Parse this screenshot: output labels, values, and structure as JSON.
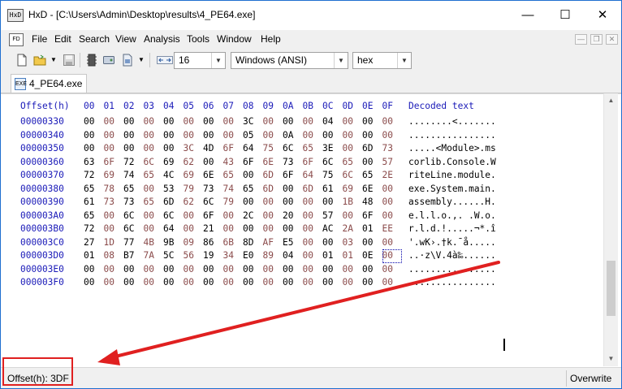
{
  "window": {
    "title": "HxD - [C:\\Users\\Admin\\Desktop\\results\\4_PE64.exe]",
    "app_icon_text": "HxD",
    "minimize": "—",
    "maximize": "☐",
    "close": "✕"
  },
  "menu": {
    "doc_icon_text": "FD",
    "items": [
      "File",
      "Edit",
      "Search",
      "View",
      "Analysis",
      "Tools",
      "Window",
      "Help"
    ],
    "mdi_buttons": [
      "—",
      "❐",
      "✕"
    ]
  },
  "toolbar": {
    "icons": [
      "new-icon",
      "open-icon",
      "save-icon",
      "ram-icon",
      "disk-icon",
      "file-icon",
      "bytes-per-row-icon"
    ],
    "bytes_per_row": "16",
    "charset": "Windows (ANSI)",
    "offset_base": "hex"
  },
  "tab": {
    "icon_text": "EXE",
    "label": "4_PE64.exe"
  },
  "hex_view": {
    "offset_header": "Offset(h)",
    "column_headers": [
      "00",
      "01",
      "02",
      "03",
      "04",
      "05",
      "06",
      "07",
      "08",
      "09",
      "0A",
      "0B",
      "0C",
      "0D",
      "0E",
      "0F"
    ],
    "decoded_header": "Decoded text",
    "rows": [
      {
        "offset": "00000330",
        "bytes": [
          "00",
          "00",
          "00",
          "00",
          "00",
          "00",
          "00",
          "00",
          "3C",
          "00",
          "00",
          "00",
          "04",
          "00",
          "00",
          "00"
        ],
        "text": "........<......."
      },
      {
        "offset": "00000340",
        "bytes": [
          "00",
          "00",
          "00",
          "00",
          "00",
          "00",
          "00",
          "00",
          "05",
          "00",
          "0A",
          "00",
          "00",
          "00",
          "00",
          "00"
        ],
        "text": "................"
      },
      {
        "offset": "00000350",
        "bytes": [
          "00",
          "00",
          "00",
          "00",
          "00",
          "3C",
          "4D",
          "6F",
          "64",
          "75",
          "6C",
          "65",
          "3E",
          "00",
          "6D",
          "73"
        ],
        "text": ".....<Module>.ms"
      },
      {
        "offset": "00000360",
        "bytes": [
          "63",
          "6F",
          "72",
          "6C",
          "69",
          "62",
          "00",
          "43",
          "6F",
          "6E",
          "73",
          "6F",
          "6C",
          "65",
          "00",
          "57"
        ],
        "text": "corlib.Console.W"
      },
      {
        "offset": "00000370",
        "bytes": [
          "72",
          "69",
          "74",
          "65",
          "4C",
          "69",
          "6E",
          "65",
          "00",
          "6D",
          "6F",
          "64",
          "75",
          "6C",
          "65",
          "2E"
        ],
        "text": "riteLine.module."
      },
      {
        "offset": "00000380",
        "bytes": [
          "65",
          "78",
          "65",
          "00",
          "53",
          "79",
          "73",
          "74",
          "65",
          "6D",
          "00",
          "6D",
          "61",
          "69",
          "6E",
          "00"
        ],
        "text": "exe.System.main."
      },
      {
        "offset": "00000390",
        "bytes": [
          "61",
          "73",
          "73",
          "65",
          "6D",
          "62",
          "6C",
          "79",
          "00",
          "00",
          "00",
          "00",
          "00",
          "1B",
          "48",
          "00"
        ],
        "text": "assembly......H."
      },
      {
        "offset": "000003A0",
        "bytes": [
          "65",
          "00",
          "6C",
          "00",
          "6C",
          "00",
          "6F",
          "00",
          "2C",
          "00",
          "20",
          "00",
          "57",
          "00",
          "6F",
          "00"
        ],
        "text": "e.l.l.o.,. .W.o."
      },
      {
        "offset": "000003B0",
        "bytes": [
          "72",
          "00",
          "6C",
          "00",
          "64",
          "00",
          "21",
          "00",
          "00",
          "00",
          "00",
          "00",
          "AC",
          "2A",
          "01",
          "EE"
        ],
        "text": "r.l.d.!.....¬*.î"
      },
      {
        "offset": "000003C0",
        "bytes": [
          "27",
          "1D",
          "77",
          "4B",
          "9B",
          "09",
          "86",
          "6B",
          "8D",
          "AF",
          "E5",
          "00",
          "00",
          "03",
          "00",
          "00"
        ],
        "text": "'.wK›.†k.¯å....."
      },
      {
        "offset": "000003D0",
        "bytes": [
          "01",
          "08",
          "B7",
          "7A",
          "5C",
          "56",
          "19",
          "34",
          "E0",
          "89",
          "04",
          "00",
          "01",
          "01",
          "0E",
          "00"
        ],
        "text": "..·z\\V.4à‰......"
      },
      {
        "offset": "000003E0",
        "bytes": [
          "00",
          "00",
          "00",
          "00",
          "00",
          "00",
          "00",
          "00",
          "00",
          "00",
          "00",
          "00",
          "00",
          "00",
          "00",
          "00"
        ],
        "text": "................"
      },
      {
        "offset": "000003F0",
        "bytes": [
          "00",
          "00",
          "00",
          "00",
          "00",
          "00",
          "00",
          "00",
          "00",
          "00",
          "00",
          "00",
          "00",
          "00",
          "00",
          "00"
        ],
        "text": "................"
      }
    ],
    "selected_offset": "000003DF"
  },
  "status": {
    "offset_text": "Offset(h): 3DF",
    "mode_text": "Overwrite"
  },
  "annotation": {
    "color": "#e02020"
  }
}
